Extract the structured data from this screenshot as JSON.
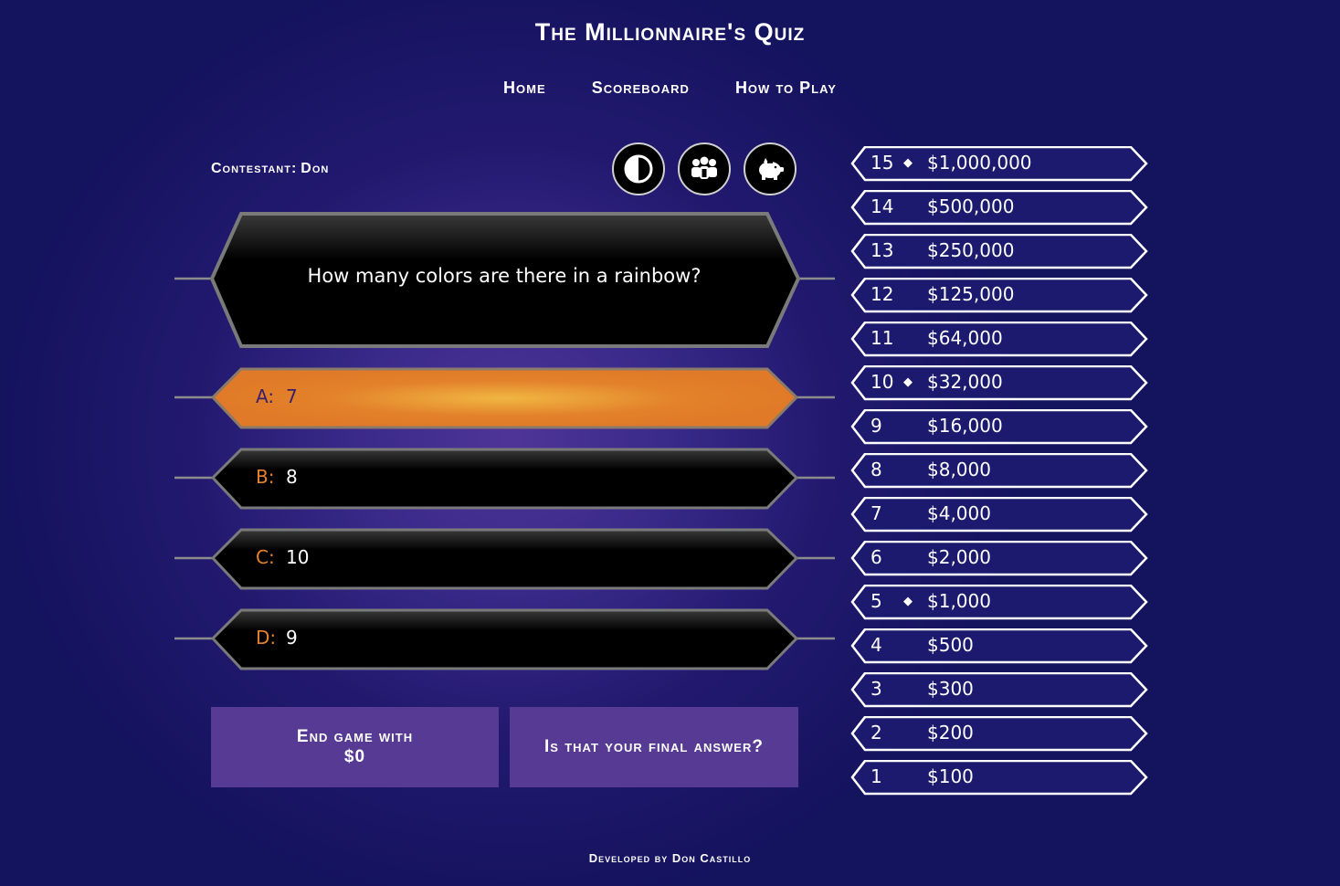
{
  "header": {
    "title": "The Millionnaire's Quiz"
  },
  "nav": {
    "items": [
      "Home",
      "Scoreboard",
      "How to Play"
    ]
  },
  "contestant": {
    "label": "Contestant:",
    "name": "Don"
  },
  "lifelines": [
    {
      "icon": "fifty-fifty-icon"
    },
    {
      "icon": "ask-audience-icon"
    },
    {
      "icon": "piggy-bank-icon"
    }
  ],
  "question": {
    "text": "How many colors are there in a rainbow?"
  },
  "answers": [
    {
      "letter": "A:",
      "text": "7",
      "selected": true
    },
    {
      "letter": "B:",
      "text": "8",
      "selected": false
    },
    {
      "letter": "C:",
      "text": "10",
      "selected": false
    },
    {
      "letter": "D:",
      "text": "9",
      "selected": false
    }
  ],
  "actions": {
    "end_game_line1": "End game with",
    "end_game_amount": "$0",
    "final_answer": "Is that your final answer?"
  },
  "prize_ladder": [
    {
      "level": "15",
      "amount": "$1,000,000",
      "milestone": true
    },
    {
      "level": "14",
      "amount": "$500,000",
      "milestone": false
    },
    {
      "level": "13",
      "amount": "$250,000",
      "milestone": false
    },
    {
      "level": "12",
      "amount": "$125,000",
      "milestone": false
    },
    {
      "level": "11",
      "amount": "$64,000",
      "milestone": false
    },
    {
      "level": "10",
      "amount": "$32,000",
      "milestone": true
    },
    {
      "level": "9",
      "amount": "$16,000",
      "milestone": false
    },
    {
      "level": "8",
      "amount": "$8,000",
      "milestone": false
    },
    {
      "level": "7",
      "amount": "$4,000",
      "milestone": false
    },
    {
      "level": "6",
      "amount": "$2,000",
      "milestone": false
    },
    {
      "level": "5",
      "amount": "$1,000",
      "milestone": true
    },
    {
      "level": "4",
      "amount": "$500",
      "milestone": false
    },
    {
      "level": "3",
      "amount": "$300",
      "milestone": false
    },
    {
      "level": "2",
      "amount": "$200",
      "milestone": false
    },
    {
      "level": "1",
      "amount": "$100",
      "milestone": false
    }
  ],
  "milestone_symbol": "◆",
  "footer": {
    "text": "Developed by Don Castillo"
  },
  "colors": {
    "accent_orange": "#e5822d",
    "button_purple": "#563a93",
    "ladder_blue": "#1c1a6e",
    "background_center": "#4e3597",
    "background_edge": "#14135e"
  }
}
